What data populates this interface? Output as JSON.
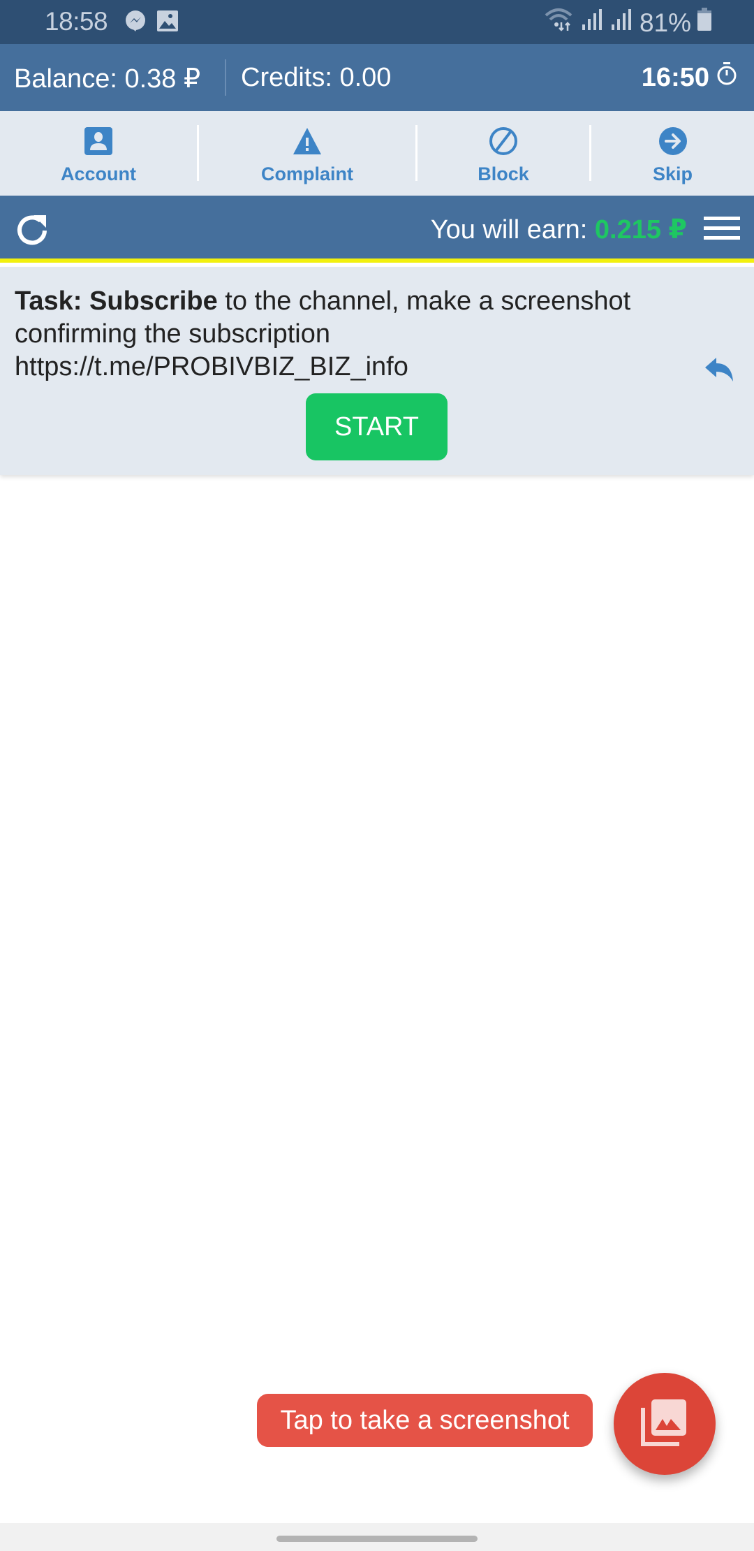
{
  "status_bar": {
    "time": "18:58",
    "left_icons": [
      "messenger-icon",
      "gallery-icon"
    ],
    "right_icons": [
      "wifi-icon",
      "signal-icon",
      "signal-icon"
    ],
    "battery": "81%"
  },
  "balance_bar": {
    "balance_label": "Balance: 0.38 ₽",
    "credits_label": "Credits: 0.00",
    "timer": "16:50",
    "timer_icon": "stopwatch-icon"
  },
  "actions": [
    {
      "label": "Account",
      "icon": "account-icon"
    },
    {
      "label": "Complaint",
      "icon": "warning-icon"
    },
    {
      "label": "Block",
      "icon": "block-icon"
    },
    {
      "label": "Skip",
      "icon": "arrow-right-circle-icon"
    }
  ],
  "earn_bar": {
    "refresh_icon": "refresh-icon",
    "earn_label": "You will earn: ",
    "earn_amount": "0.215 ₽",
    "menu_icon": "hamburger-menu-icon"
  },
  "task": {
    "prefix": "Task: Subscribe",
    "text": " to the channel, make a screenshot confirming the subscription",
    "link": "https://t.me/PROBIVBIZ_BIZ_info",
    "share_icon": "reply-icon",
    "start_label": "START"
  },
  "screenshot": {
    "tip_label": "Tap to take a screenshot",
    "fab_icon": "photo-library-icon"
  },
  "colors": {
    "status_bar": "#2e4f73",
    "header": "#456f9c",
    "accent_blue": "#3d84c6",
    "earn_green": "#1ec762",
    "start_green": "#18c563",
    "highlight_yellow": "#f2f00e",
    "screenshot_red": "#dc4538"
  }
}
